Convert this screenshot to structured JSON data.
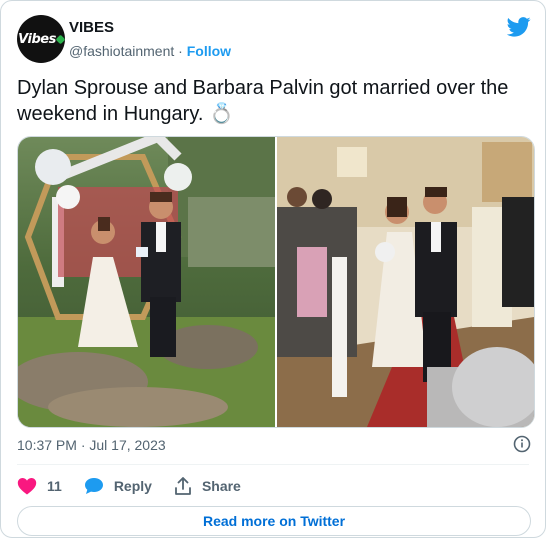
{
  "account": {
    "display_name": "VIBES",
    "avatar_text": "Vibes",
    "handle": "@fashiotainment",
    "separator": "·",
    "follow_label": "Follow"
  },
  "tweet": {
    "text": "Dylan Sprouse and Barbara Palvin got married over the weekend in Hungary. 💍",
    "timestamp": "10:37 PM · Jul 17, 2023"
  },
  "media": {
    "photo_count": 2
  },
  "actions": {
    "likes_count": "11",
    "reply_label": "Reply",
    "share_label": "Share"
  },
  "footer": {
    "read_more_label": "Read more on Twitter"
  },
  "colors": {
    "twitter_blue": "#1d9bf0",
    "like_red": "#f91880",
    "link_blue": "#006fd6",
    "secondary_text": "#536471"
  },
  "icons": [
    "twitter-bird-icon",
    "info-icon",
    "heart-icon",
    "reply-bubble-icon",
    "share-icon"
  ]
}
